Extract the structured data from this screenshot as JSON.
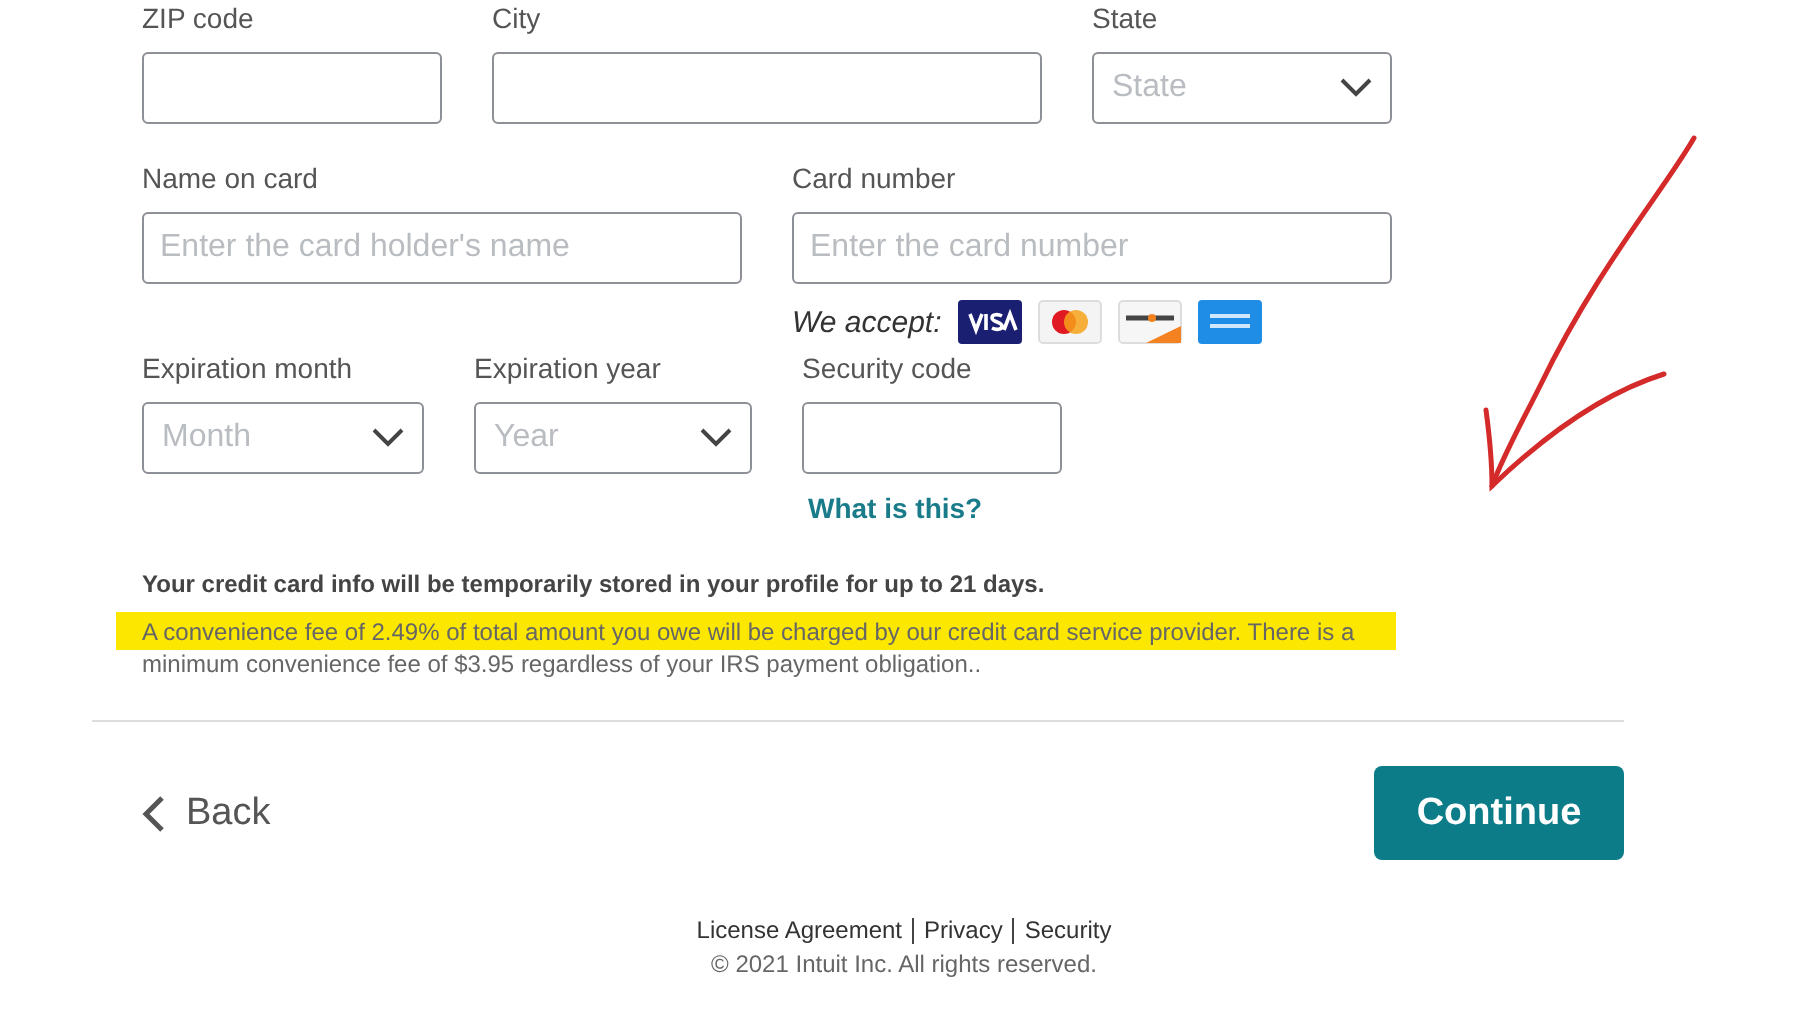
{
  "address_row": [
    {
      "label": "ZIP code",
      "kind": "input"
    },
    {
      "label": "City",
      "kind": "input"
    },
    {
      "label": "State",
      "kind": "select",
      "placeholder": "State"
    }
  ],
  "card_row": [
    {
      "label": "Name on card",
      "kind": "input",
      "placeholder": "Enter the card holder's name"
    },
    {
      "label": "Card number",
      "kind": "input",
      "placeholder": "Enter the card number"
    }
  ],
  "we_accept": "We accept:",
  "expiry_row": [
    {
      "label": "Expiration month",
      "kind": "select",
      "placeholder": "Month"
    },
    {
      "label": "Expiration year",
      "kind": "select",
      "placeholder": "Year"
    },
    {
      "label": "Security code",
      "kind": "input"
    }
  ],
  "help_link": "What is this?",
  "notes": [
    {
      "text": "Your credit card info will be temporarily stored in your profile for up to 21 days.",
      "highlighted": false,
      "bold": true
    },
    {
      "text": "A convenience fee of 2.49% of total amount you owe will be charged by our credit card service provider. There is a minimum convenience fee of $3.95 regardless of your IRS payment obligation..",
      "highlighted": true,
      "bold": false
    }
  ],
  "back_button": "Back",
  "continue_button": "Continue",
  "footer": {
    "links": [
      "License Agreement",
      "Privacy",
      "Security"
    ],
    "copyright": "© 2021 Intuit Inc. All rights reserved."
  }
}
